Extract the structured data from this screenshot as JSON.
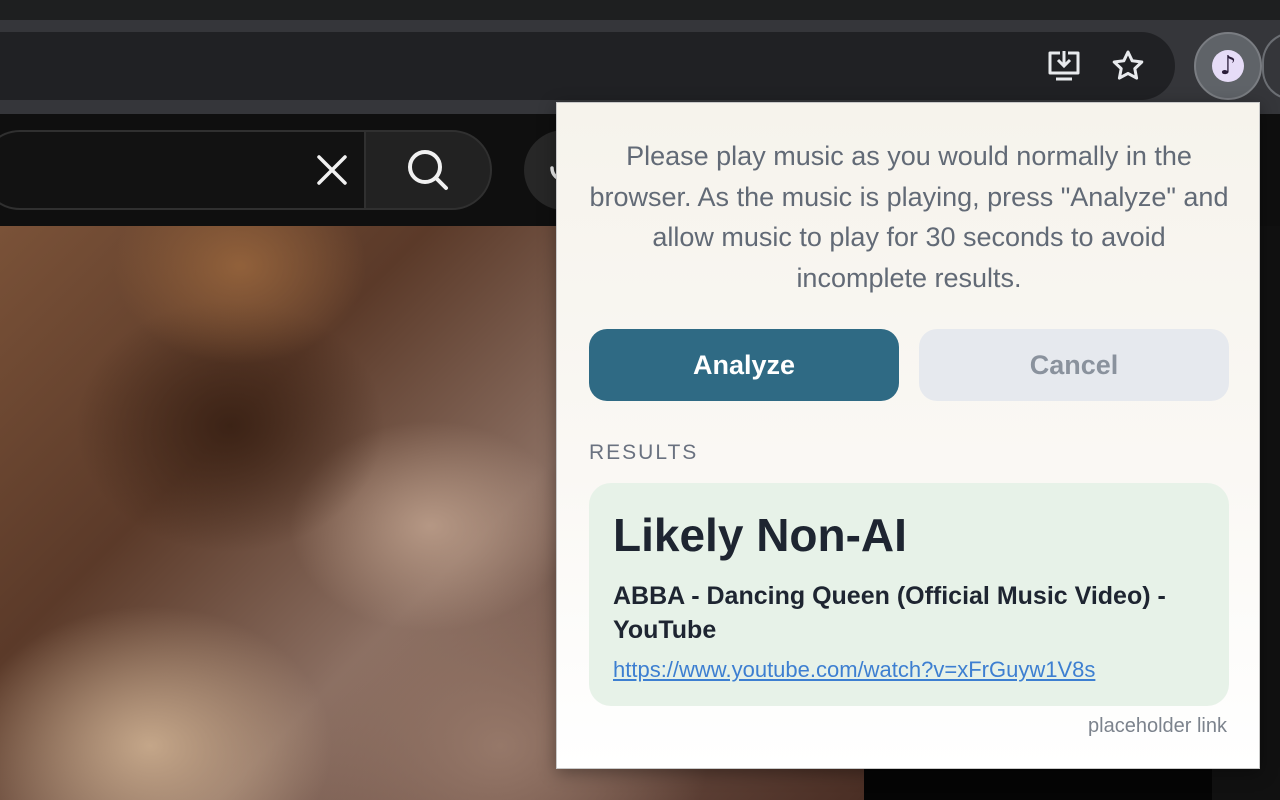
{
  "browser": {
    "toolbar_icons": [
      "install-app-icon",
      "bookmark-star-icon"
    ],
    "extension_icon": "music-note-icon",
    "extension_glyph": "♪"
  },
  "youtube": {
    "search": {
      "value": "",
      "clear_icon": "close-icon",
      "search_icon": "search-icon",
      "voice_icon": "microphone-icon"
    }
  },
  "popup": {
    "instructions": "Please play music as you would normally in the browser. As the music is playing, press \"Analyze\" and allow music to play for 30 seconds to avoid incomplete results.",
    "analyze_label": "Analyze",
    "cancel_label": "Cancel",
    "results_heading": "RESULTS",
    "result": {
      "verdict": "Likely Non-AI",
      "title": "ABBA - Dancing Queen (Official Music Video) - YouTube",
      "url": "https://www.youtube.com/watch?v=xFrGuyw1V8s"
    },
    "footer_link": "placeholder link"
  },
  "colors": {
    "analyze_bg": "#2f6a84",
    "cancel_bg": "#e6e9ee",
    "result_card_bg": "#e7f2e8",
    "link": "#3d7fd1"
  }
}
